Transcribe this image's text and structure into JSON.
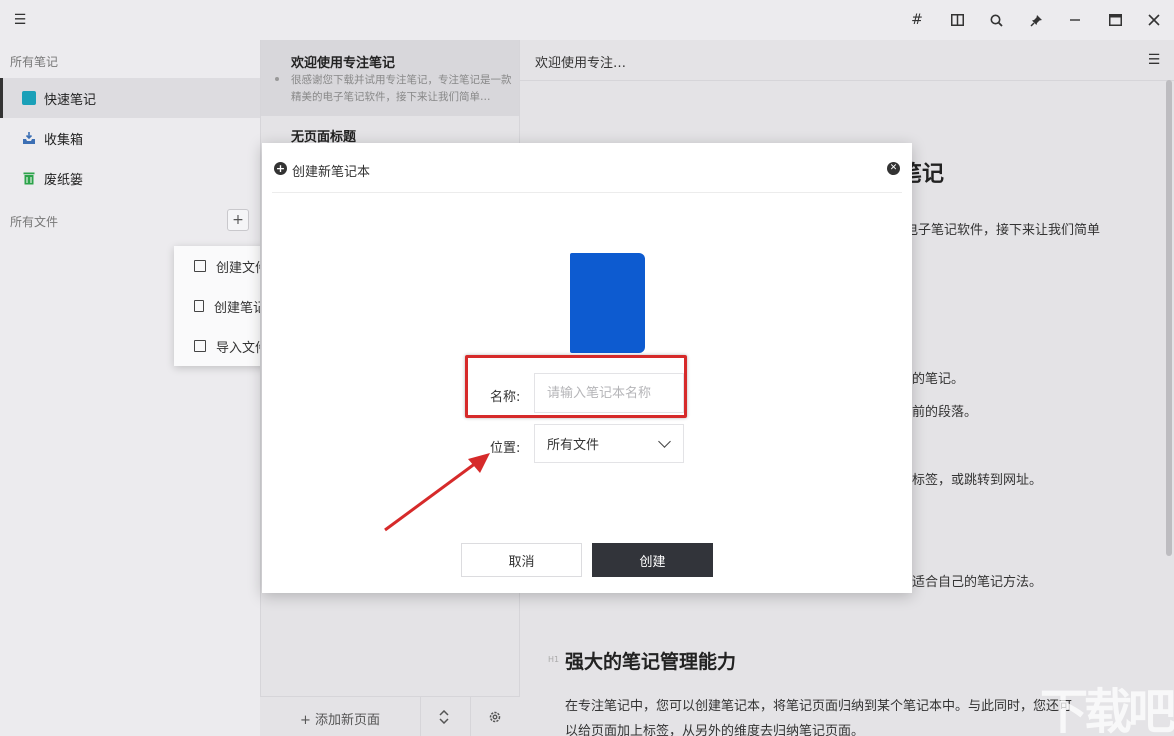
{
  "titlebar": {
    "icons": [
      "menu-icon",
      "hash-icon",
      "columns-icon",
      "search-icon",
      "pin-icon",
      "minimize-icon",
      "maximize-icon",
      "close-icon"
    ]
  },
  "sidebar": {
    "section_notes": "所有笔记",
    "items": [
      {
        "label": "快速笔记",
        "icon": "note-icon",
        "color": "#1aa0b8"
      },
      {
        "label": "收集箱",
        "icon": "inbox-icon",
        "color": "#3c6fb4"
      },
      {
        "label": "废纸篓",
        "icon": "trash-icon",
        "color": "#2ca34a"
      }
    ],
    "section_files": "所有文件",
    "add_button": "+"
  },
  "context_menu": {
    "items": [
      {
        "label": "创建文件夹",
        "icon": "folder-icon"
      },
      {
        "label": "创建笔记本",
        "icon": "notebook-icon"
      },
      {
        "label": "导入文件",
        "icon": "import-icon"
      }
    ]
  },
  "notelist": {
    "notes": [
      {
        "title": "欢迎使用专注笔记",
        "snippet": "很感谢您下载并试用专注笔记，专注笔记是一款精美的电子笔记软件，接下来让我们简单…"
      },
      {
        "title": "无页面标题",
        "snippet": ""
      }
    ],
    "footer": {
      "add_page": "+ 添加新页面"
    }
  },
  "editor": {
    "title": "欢迎使用专注…",
    "heading_fragment": "笔记",
    "lines": [
      "电子笔记软件，接下来让我们简单",
      "的笔记。",
      "前的段落。",
      "标签，或跳转到网址。",
      "适合自己的笔记方法。"
    ],
    "h1_mark": "H1",
    "section_heading": "强大的笔记管理能力",
    "para_1": "在专注笔记中，您可以创建笔记本，将笔记页面归纳到某个笔记本中。与此同时，您还可",
    "para_2": "以给页面加上标签，从另外的维度去归纳笔记页面。"
  },
  "dialog": {
    "title": "创建新笔记本",
    "name_label": "名称:",
    "name_placeholder": "请输入笔记本名称",
    "location_label": "位置:",
    "location_value": "所有文件",
    "cancel_label": "取消",
    "create_label": "创建",
    "cover_color": "#0d5bd0"
  },
  "watermark": "下载吧"
}
